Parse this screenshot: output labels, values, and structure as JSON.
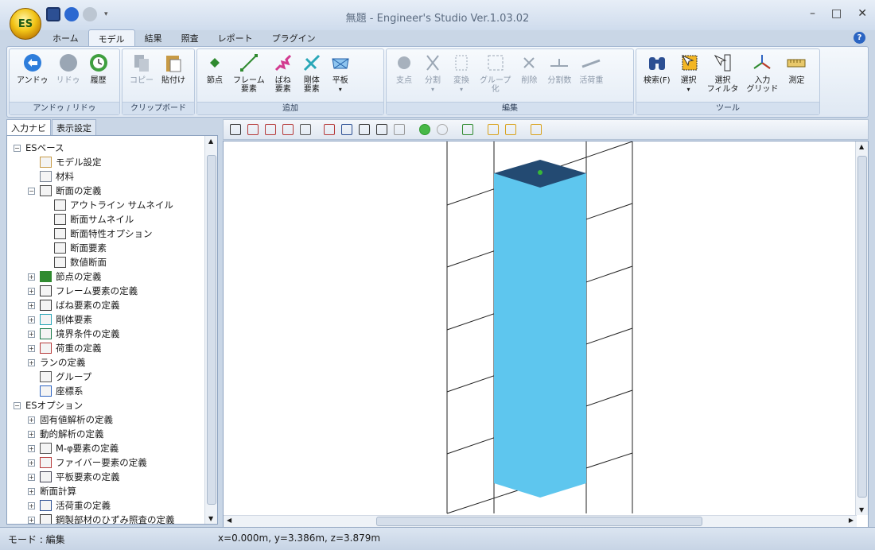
{
  "app": {
    "logo": "ES",
    "title": "無題 - Engineer's Studio Ver.1.03.02"
  },
  "window_controls": {
    "minimize": "–",
    "maximize": "□",
    "close": "✕"
  },
  "tabs": [
    "ホーム",
    "モデル",
    "結果",
    "照査",
    "レポート",
    "プラグイン"
  ],
  "help": "?",
  "ribbon": {
    "undo": {
      "label": "アンドゥ / リドゥ",
      "items": [
        "アンドゥ",
        "リドゥ",
        "履歴"
      ]
    },
    "clip": {
      "label": "クリップボード",
      "items": [
        "コピー",
        "貼付け"
      ]
    },
    "add": {
      "label": "追加",
      "items": [
        "節点",
        "フレーム\n要素",
        "ばね\n要素",
        "剛体\n要素",
        "平板"
      ]
    },
    "edit": {
      "label": "編集",
      "items": [
        "支点",
        "分割",
        "変換",
        "グループ\n化",
        "削除",
        "分割数",
        "活荷重"
      ]
    },
    "tool": {
      "label": "ツール",
      "items": [
        "検索(F)",
        "選択",
        "選択\nフィルタ",
        "入力\nグリッド",
        "測定"
      ]
    }
  },
  "panel": {
    "tabs": [
      "入力ナビ",
      "表示設定"
    ]
  },
  "tree": [
    {
      "l": 0,
      "t": "−",
      "label": "ESベース",
      "icon": "none"
    },
    {
      "l": 1,
      "t": "",
      "label": "モデル設定",
      "icon": "doc"
    },
    {
      "l": 1,
      "t": "",
      "label": "材料",
      "icon": "mat"
    },
    {
      "l": 1,
      "t": "−",
      "label": "断面の定義",
      "icon": "sect"
    },
    {
      "l": 2,
      "t": "",
      "label": "アウトライン サムネイル",
      "icon": "sect"
    },
    {
      "l": 2,
      "t": "",
      "label": "断面サムネイル",
      "icon": "sect"
    },
    {
      "l": 2,
      "t": "",
      "label": "断面特性オプション",
      "icon": "sect"
    },
    {
      "l": 2,
      "t": "",
      "label": "断面要素",
      "icon": "sect"
    },
    {
      "l": 2,
      "t": "",
      "label": "数値断面",
      "icon": "sect"
    },
    {
      "l": 1,
      "t": "+",
      "label": "節点の定義",
      "icon": "node"
    },
    {
      "l": 1,
      "t": "+",
      "label": "フレーム要素の定義",
      "icon": "frame"
    },
    {
      "l": 1,
      "t": "+",
      "label": "ばね要素の定義",
      "icon": "spring"
    },
    {
      "l": 1,
      "t": "+",
      "label": "剛体要素",
      "icon": "rigid"
    },
    {
      "l": 1,
      "t": "+",
      "label": "境界条件の定義",
      "icon": "bound"
    },
    {
      "l": 1,
      "t": "+",
      "label": "荷重の定義",
      "icon": "load"
    },
    {
      "l": 1,
      "t": "+",
      "label": "ランの定義",
      "icon": "none"
    },
    {
      "l": 1,
      "t": "",
      "label": "グループ",
      "icon": "group"
    },
    {
      "l": 1,
      "t": "",
      "label": "座標系",
      "icon": "axis"
    },
    {
      "l": 0,
      "t": "−",
      "label": "ESオプション",
      "icon": "none"
    },
    {
      "l": 1,
      "t": "+",
      "label": "固有値解析の定義",
      "icon": "none"
    },
    {
      "l": 1,
      "t": "+",
      "label": "動的解析の定義",
      "icon": "none"
    },
    {
      "l": 1,
      "t": "+",
      "label": "M-φ要素の定義",
      "icon": "mphi"
    },
    {
      "l": 1,
      "t": "+",
      "label": "ファイバー要素の定義",
      "icon": "fiber"
    },
    {
      "l": 1,
      "t": "+",
      "label": "平板要素の定義",
      "icon": "plate"
    },
    {
      "l": 1,
      "t": "+",
      "label": "断面計算",
      "icon": "none"
    },
    {
      "l": 1,
      "t": "+",
      "label": "活荷重の定義",
      "icon": "live"
    },
    {
      "l": 1,
      "t": "+",
      "label": "鋼製部材のひずみ照査の定義",
      "icon": "steel"
    }
  ],
  "status": {
    "mode": "モード : 編集",
    "coords": "x=0.000m, y=3.386m, z=3.879m"
  },
  "colors": {
    "column": "#5ec6ee",
    "column_top": "#234a72"
  },
  "icons": {
    "scroll_h_grip": "grip-icon",
    "scroll_v_grip": "grip-icon"
  }
}
